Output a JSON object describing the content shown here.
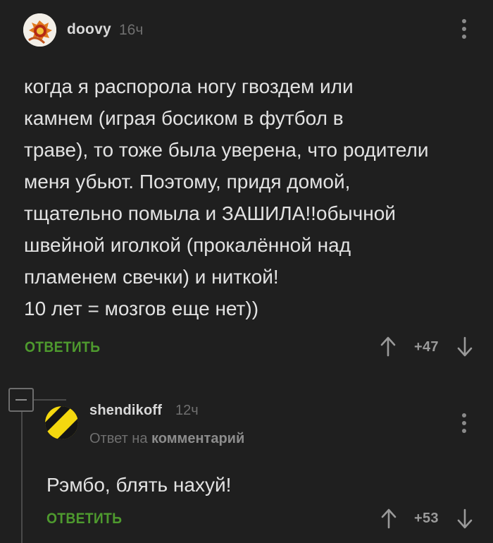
{
  "comments": [
    {
      "username": "doovy",
      "time": "16ч",
      "text": "когда я распорола ногу гвоздем или\nкамнем  (играя босиком  в футбол в\nтраве), то тоже была уверена, что родители\nменя убьют. Поэтому, придя домой,\nтщательно помыла и ЗАШИЛА!!обычной\nшвейной иголкой (прокалённой над\nпламенем свечки) и ниткой!\n 10 лет = мозгов еще нет))",
      "reply_label": "ОТВЕТИТЬ",
      "score": "+47"
    },
    {
      "username": "shendikoff",
      "time": "12ч",
      "reply_prefix": "Ответ на",
      "reply_target": "комментарий",
      "text": "Рэмбо, блять нахуй!",
      "reply_label": "ОТВЕТИТЬ",
      "score": "+53"
    }
  ],
  "icons": {
    "upvote": "arrow-up-icon",
    "downvote": "arrow-down-icon",
    "menu": "more-vertical-icon",
    "collapse": "minus-box-icon"
  },
  "colors": {
    "background": "#1f1f1f",
    "accent_green": "#4e9a2e",
    "text": "#e2e2e2",
    "muted": "#6f6f6f"
  }
}
